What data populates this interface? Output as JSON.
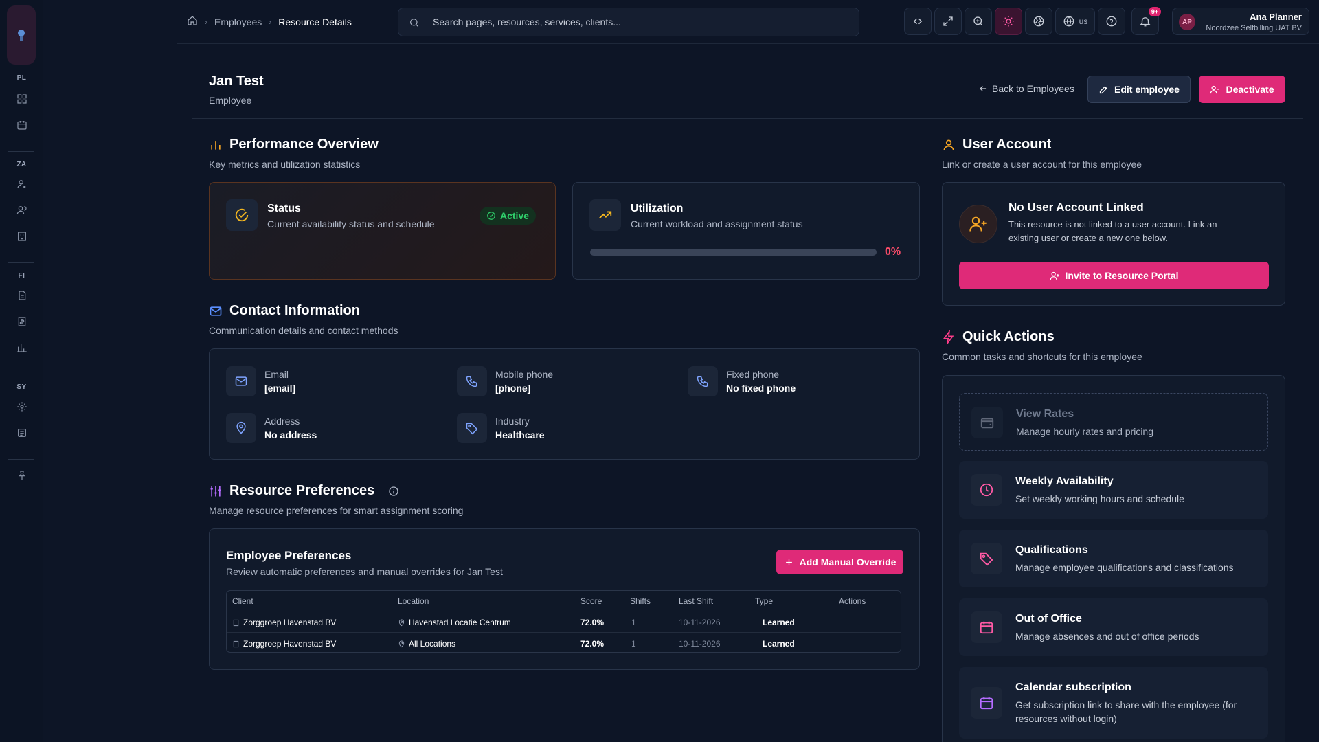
{
  "rail": {
    "sections": [
      "PL",
      "ZA",
      "FI",
      "SY"
    ]
  },
  "topbar": {
    "breadcrumbs": [
      "Employees",
      "Resource Details"
    ],
    "search_placeholder": "Search pages, resources, services, clients...",
    "locale": "us",
    "notifications": "9+",
    "user": {
      "initials": "AP",
      "name": "Ana Planner",
      "org": "Noordzee Selfbilling UAT BV"
    }
  },
  "header": {
    "name": "Jan Test",
    "role": "Employee",
    "back_label": "Back to Employees",
    "edit_label": "Edit employee",
    "deactivate_label": "Deactivate"
  },
  "performance": {
    "title": "Performance Overview",
    "subtitle": "Key metrics and utilization statistics",
    "status": {
      "title": "Status",
      "desc": "Current availability status and schedule",
      "badge": "Active"
    },
    "utilization": {
      "title": "Utilization",
      "desc": "Current workload and assignment status",
      "value": "0%",
      "fraction": 0
    }
  },
  "contact": {
    "title": "Contact Information",
    "subtitle": "Communication details and contact methods",
    "email": {
      "label": "Email",
      "value": "[email]"
    },
    "mobile": {
      "label": "Mobile phone",
      "value": "[phone]"
    },
    "fixed": {
      "label": "Fixed phone",
      "value": "No fixed phone"
    },
    "address": {
      "label": "Address",
      "value": "No address"
    },
    "industry": {
      "label": "Industry",
      "value": "Healthcare"
    }
  },
  "preferences": {
    "title": "Resource Preferences",
    "subtitle": "Manage resource preferences for smart assignment scoring",
    "card_title": "Employee Preferences",
    "card_desc": "Review automatic preferences and manual overrides for Jan Test",
    "add_label": "Add Manual Override",
    "columns": [
      "Client",
      "Location",
      "Score",
      "Shifts",
      "Last Shift",
      "Type",
      "Actions"
    ],
    "rows": [
      {
        "client": "Zorggroep Havenstad BV",
        "location": "Havenstad Locatie Centrum",
        "score": "72.0%",
        "shifts": "1",
        "last_shift": "10-11-2026",
        "type": "Learned"
      },
      {
        "client": "Zorggroep Havenstad BV",
        "location": "All Locations",
        "score": "72.0%",
        "shifts": "1",
        "last_shift": "10-11-2026",
        "type": "Learned"
      }
    ]
  },
  "user_account": {
    "title": "User Account",
    "subtitle": "Link or create a user account for this employee",
    "none_title": "No User Account Linked",
    "none_desc_1": "This resource is not linked to a user account. Link an",
    "none_desc_2": "existing user or create a new one below.",
    "invite_label": "Invite to Resource Portal"
  },
  "quick_actions": {
    "title": "Quick Actions",
    "subtitle": "Common tasks and shortcuts for this employee",
    "items": [
      {
        "title": "View Rates",
        "desc": "Manage hourly rates and pricing",
        "icon": "wallet-icon"
      },
      {
        "title": "Weekly Availability",
        "desc": "Set weekly working hours and schedule",
        "icon": "clock-icon"
      },
      {
        "title": "Qualifications",
        "desc": "Manage employee qualifications and classifications",
        "icon": "tag-icon"
      },
      {
        "title": "Out of Office",
        "desc": "Manage absences and out of office periods",
        "icon": "calendar-icon"
      },
      {
        "title": "Calendar subscription",
        "desc_1": "Get subscription link to share with the employee (for",
        "desc_2": "resources without login)",
        "icon": "calendar-icon"
      }
    ]
  },
  "colors": {
    "accent": "#df2a78",
    "success": "#2fd06b",
    "danger": "#ff4d6a",
    "background": "#0d1526"
  }
}
